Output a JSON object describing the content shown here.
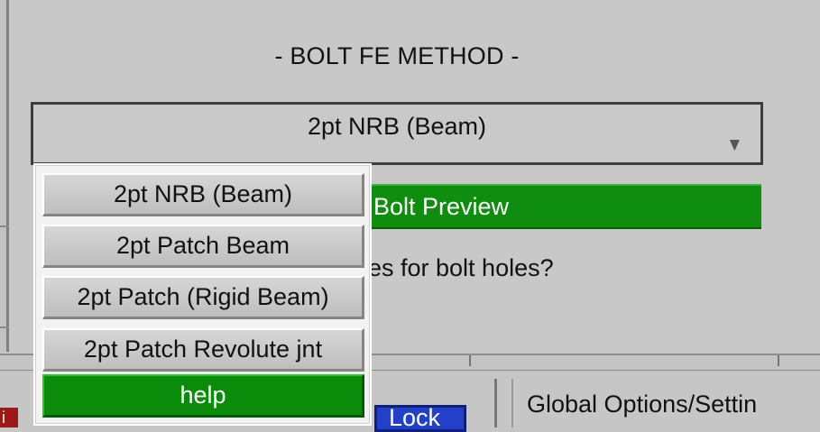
{
  "panel": {
    "title": "- BOLT FE METHOD -",
    "method_select": {
      "selected_value": "2pt NRB (Beam)",
      "arrow_icon": "dropdown-arrow-icon"
    },
    "preview_button_label": "Bolt Preview",
    "question_text": "es for bolt holes?"
  },
  "dropdown": {
    "options": [
      {
        "label": "2pt NRB (Beam)"
      },
      {
        "label": "2pt Patch Beam"
      },
      {
        "label": "2pt Patch (Rigid Beam)"
      },
      {
        "label": "2pt Patch Revolute jnt"
      },
      {
        "label": "help"
      }
    ]
  },
  "bottom_bar": {
    "red_tag_label": "i",
    "lock_label": "Lock",
    "global_options_label": "Global Options/Settin"
  },
  "colors": {
    "panel_background": "#c8c8c8",
    "green_button": "#0f8d0f",
    "help_green": "#0a8c0a",
    "lock_blue": "#2340c8",
    "red_tag": "#9f1818"
  }
}
